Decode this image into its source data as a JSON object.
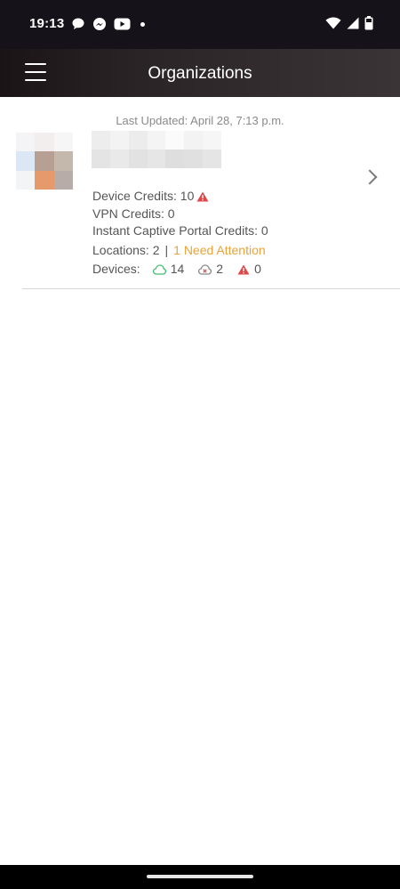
{
  "status_bar": {
    "time": "19:13"
  },
  "header": {
    "title": "Organizations"
  },
  "last_updated": "Last Updated: April 28, 7:13 p.m.",
  "organization": {
    "device_credits": "Device Credits: 10",
    "vpn_credits": "VPN Credits: 0",
    "captive_portal_credits": "Instant Captive Portal Credits: 0",
    "locations": "Locations: 2",
    "separator": "|",
    "attention": "1 Need Attention",
    "devices_label": "Devices:",
    "devices_online": "14",
    "devices_offline": "2",
    "devices_alerts": "0"
  },
  "colors": {
    "attention": "#e8a33b",
    "online": "#3fbf6f",
    "offline": "#e05050",
    "alert": "#e04848"
  }
}
